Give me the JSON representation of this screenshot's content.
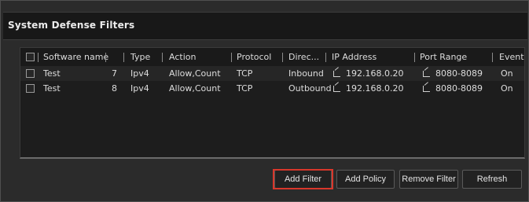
{
  "dialog": {
    "title": "System Defense Filters"
  },
  "table": {
    "columns": {
      "software_name": "Software name",
      "num": "",
      "type": "Type",
      "action": "Action",
      "protocol": "Protocol",
      "direction": "Direc...",
      "ip_address": "IP Address",
      "port_range": "Port Range",
      "event": "Event"
    },
    "rows": [
      {
        "software_name": "Test",
        "num": "7",
        "type": "Ipv4",
        "action": "Allow,Count",
        "protocol": "TCP",
        "direction": "Inbound",
        "ip_address": "192.168.0.20",
        "port_range": "8080-8089",
        "event": "On"
      },
      {
        "software_name": "Test",
        "num": "8",
        "type": "Ipv4",
        "action": "Allow,Count",
        "protocol": "TCP",
        "direction": "Outbound",
        "ip_address": "192.168.0.20",
        "port_range": "8080-8089",
        "event": "On"
      }
    ]
  },
  "buttons": {
    "add_filter": "Add Filter",
    "add_policy": "Add Policy",
    "remove_filter": "Remove Filter",
    "refresh": "Refresh"
  },
  "colors": {
    "background": "#2b2b2b",
    "panel": "#1d1d1d",
    "highlight": "#d9372b"
  }
}
